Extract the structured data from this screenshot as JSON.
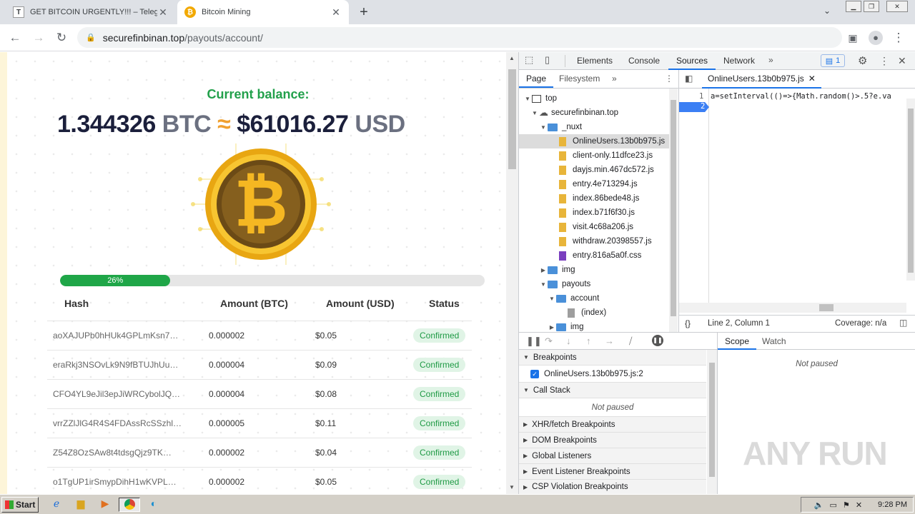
{
  "browser": {
    "tabs": [
      {
        "label": "GET BITCOIN URGENTLY!!! – Telegram",
        "favicon": "T"
      },
      {
        "label": "Bitcoin Mining",
        "favicon": "₿"
      }
    ],
    "url_host": "securefinbinan.top",
    "url_path": "/payouts/account/"
  },
  "page": {
    "balance_label": "Current balance:",
    "btc_amount": "1.344326",
    "btc_unit": "BTC",
    "approx": "≈",
    "usd_amount": "$61016.27",
    "usd_unit": "USD",
    "progress_percent": 26,
    "progress_label": "26%",
    "table": {
      "headers": [
        "Hash",
        "Amount (BTC)",
        "Amount (USD)",
        "Status"
      ],
      "rows": [
        {
          "hash": "aoXAJUPb0hHUk4GPLmKsn7…",
          "btc": "0.000002",
          "usd": "$0.05",
          "status": "Confirmed"
        },
        {
          "hash": "eraRkj3NSOvLk9N9fBTUJhUu…",
          "btc": "0.000004",
          "usd": "$0.09",
          "status": "Confirmed"
        },
        {
          "hash": "CFO4YL9eJil3epJiWRCybolJQ…",
          "btc": "0.000004",
          "usd": "$0.08",
          "status": "Confirmed"
        },
        {
          "hash": "vrrZZlJlG4R4S4FDAssRcSSzhl…",
          "btc": "0.000005",
          "usd": "$0.11",
          "status": "Confirmed"
        },
        {
          "hash": "Z54Z8OzSAw8t4tdsgQjz9TK…",
          "btc": "0.000002",
          "usd": "$0.04",
          "status": "Confirmed"
        },
        {
          "hash": "o1TgUP1irSmypDihH1wKVPL…",
          "btc": "0.000002",
          "usd": "$0.05",
          "status": "Confirmed"
        }
      ]
    }
  },
  "devtools": {
    "tabs": [
      "Elements",
      "Console",
      "Sources",
      "Network"
    ],
    "issues_count": "1",
    "nav_tabs": [
      "Page",
      "Filesystem"
    ],
    "tree": [
      {
        "label": "top"
      },
      {
        "label": "securefinbinan.top"
      },
      {
        "label": "_nuxt"
      },
      {
        "label": "OnlineUsers.13b0b975.js"
      },
      {
        "label": "client-only.11dfce23.js"
      },
      {
        "label": "dayjs.min.467dc572.js"
      },
      {
        "label": "entry.4e713294.js"
      },
      {
        "label": "index.86bede48.js"
      },
      {
        "label": "index.b71f6f30.js"
      },
      {
        "label": "visit.4c68a206.js"
      },
      {
        "label": "withdraw.20398557.js"
      },
      {
        "label": "entry.816a5a0f.css"
      },
      {
        "label": "img"
      },
      {
        "label": "payouts"
      },
      {
        "label": "account"
      },
      {
        "label": "(index)"
      },
      {
        "label": "img"
      }
    ],
    "editor_tab": "OnlineUsers.13b0b975.js",
    "line_numbers": [
      "1",
      "2"
    ],
    "code_line1": "a=setInterval(()=>{Math.random()>.5?e.va",
    "status_position": "Line 2, Column 1",
    "coverage": "Coverage: n/a",
    "sections": {
      "breakpoints": "Breakpoints",
      "breakpoint_item": "OnlineUsers.13b0b975.js:2",
      "call_stack": "Call Stack",
      "not_paused": "Not paused",
      "xhr": "XHR/fetch Breakpoints",
      "dom": "DOM Breakpoints",
      "global": "Global Listeners",
      "event": "Event Listener Breakpoints",
      "csp": "CSP Violation Breakpoints"
    },
    "scope_tabs": [
      "Scope",
      "Watch"
    ],
    "scope_status": "Not paused"
  },
  "taskbar": {
    "start": "Start",
    "time": "9:28 PM"
  },
  "watermark": "ANY RUN",
  "colors": {
    "accent_green": "#1fa648",
    "devtools_blue": "#1a73e8"
  }
}
